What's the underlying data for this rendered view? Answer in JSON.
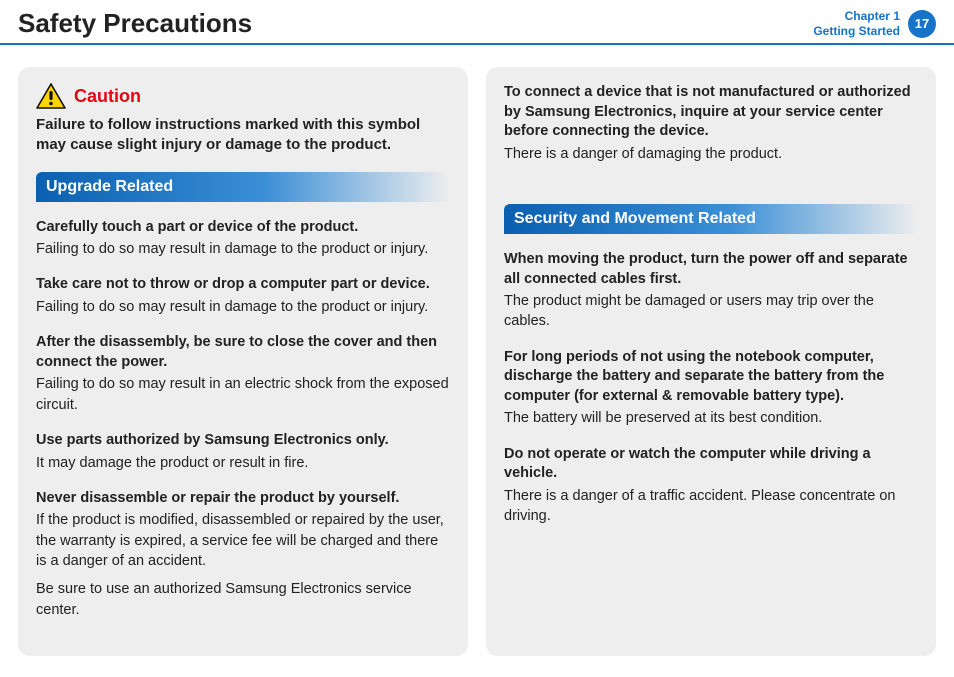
{
  "header": {
    "title": "Safety Precautions",
    "chapter_line1": "Chapter 1",
    "chapter_line2": "Getting Started",
    "page_number": "17"
  },
  "caution": {
    "label": "Caution",
    "body": "Failure to follow instructions marked with this symbol may cause slight injury or damage to the product."
  },
  "left": {
    "section_title": "Upgrade Related",
    "items": [
      {
        "head": "Carefully touch a part or device of the product.",
        "body": "Failing to do so may result in damage to the product or injury."
      },
      {
        "head": "Take care not to throw or drop a computer part or device.",
        "body": "Failing to do so may result in damage to the product or injury."
      },
      {
        "head": "After the disassembly, be sure to close the cover and then connect the power.",
        "body": "Failing to do so may result in an electric shock from the exposed circuit."
      },
      {
        "head": "Use parts authorized by Samsung Electronics only.",
        "body": "It may damage the product or result in fire."
      },
      {
        "head": "Never disassemble or repair the product by yourself.",
        "body": "If the product is modified, disassembled or repaired by the user, the warranty is expired, a service fee will be charged and there is a danger of an accident.",
        "body2": "Be sure to use an authorized Samsung Electronics service center."
      }
    ]
  },
  "right": {
    "top_item": {
      "head": "To connect a device that is not manufactured or authorized by Samsung Electronics, inquire at your service center before connecting the device.",
      "body": "There is a danger of damaging the product."
    },
    "section_title": "Security and Movement Related",
    "items": [
      {
        "head": "When moving the product, turn the power off and separate all connected cables first.",
        "body": "The product might be damaged or users may trip over the cables."
      },
      {
        "head": "For long periods of not using the notebook computer, discharge the battery and separate the battery from the computer (for external & removable battery type).",
        "body": "The battery will be preserved at its best condition."
      },
      {
        "head": "Do not operate or watch the computer while driving a vehicle.",
        "body": "There is a danger of a traffic accident. Please concentrate on driving."
      }
    ]
  }
}
